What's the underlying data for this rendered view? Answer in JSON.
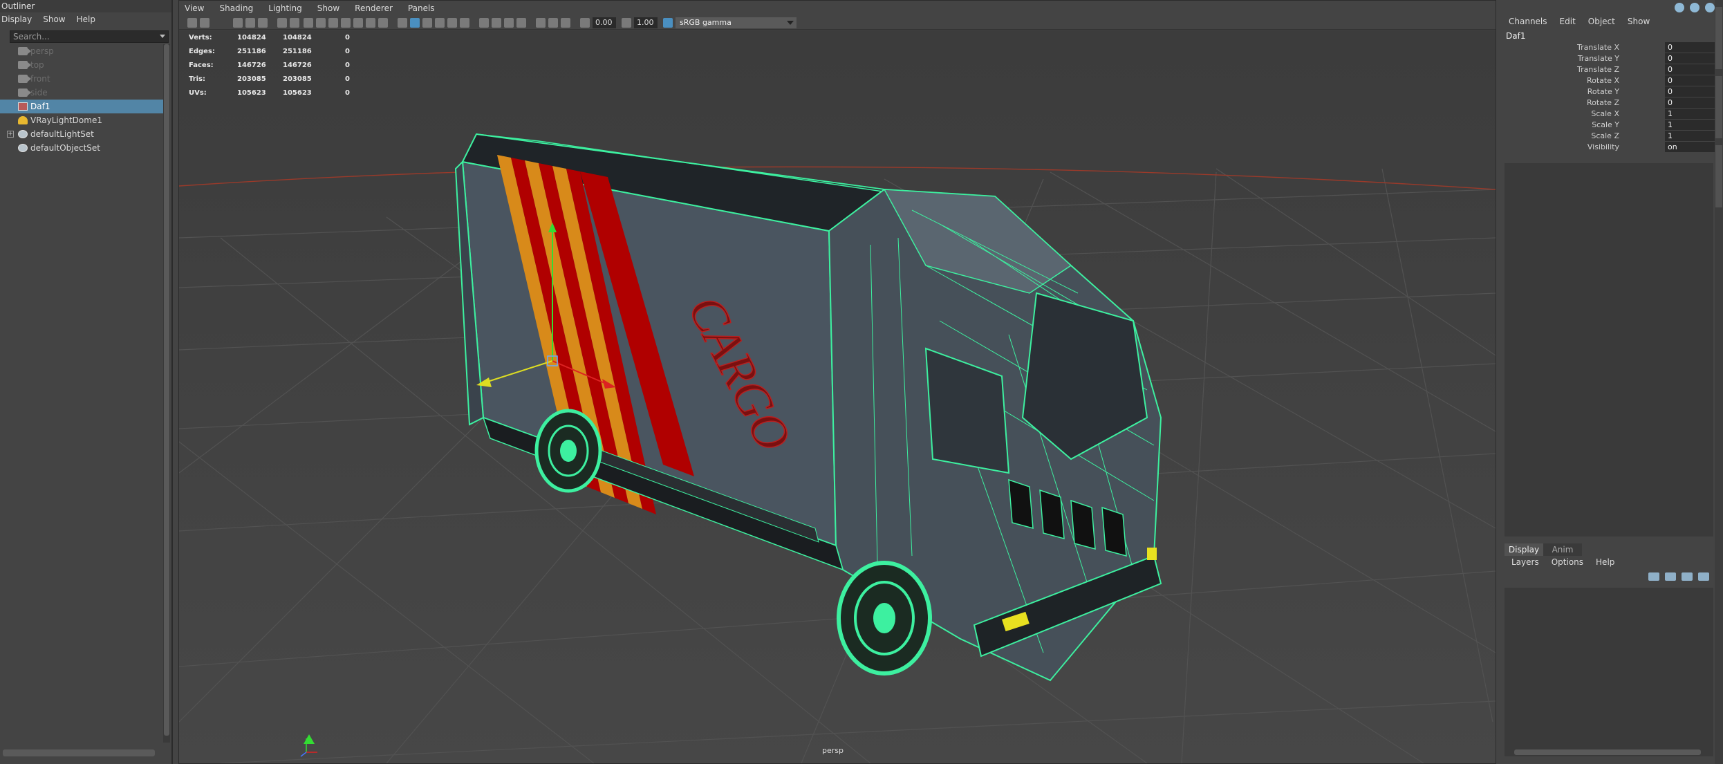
{
  "outliner": {
    "title": "Outliner",
    "menu": [
      "Display",
      "Show",
      "Help"
    ],
    "search_placeholder": "Search...",
    "items": [
      {
        "label": "persp",
        "icon": "camera-icon",
        "dim": true
      },
      {
        "label": "top",
        "icon": "camera-icon",
        "dim": true
      },
      {
        "label": "front",
        "icon": "camera-icon",
        "dim": true
      },
      {
        "label": "side",
        "icon": "camera-icon",
        "dim": true
      },
      {
        "label": "Daf1",
        "icon": "mesh-group-icon",
        "selected": true
      },
      {
        "label": "VRayLightDome1",
        "icon": "dome-light-icon"
      },
      {
        "label": "defaultLightSet",
        "icon": "set-icon",
        "expandable": true
      },
      {
        "label": "defaultObjectSet",
        "icon": "set-icon"
      }
    ]
  },
  "viewport": {
    "menu": [
      "View",
      "Shading",
      "Lighting",
      "Show",
      "Renderer",
      "Panels"
    ],
    "exposure": "0.00",
    "gamma": "1.00",
    "color_space": "sRGB gamma",
    "camera": "persp",
    "stats": [
      {
        "label": "Verts:",
        "v1": "104824",
        "v2": "104824",
        "v3": "0"
      },
      {
        "label": "Edges:",
        "v1": "251186",
        "v2": "251186",
        "v3": "0"
      },
      {
        "label": "Faces:",
        "v1": "146726",
        "v2": "146726",
        "v3": "0"
      },
      {
        "label": "Tris:",
        "v1": "203085",
        "v2": "203085",
        "v3": "0"
      },
      {
        "label": "UVs:",
        "v1": "105623",
        "v2": "105623",
        "v3": "0"
      }
    ],
    "truck_text": "CARGO",
    "colors": {
      "wireframe": "#3df0a0",
      "body": "#4a5560",
      "stripe_orange": "#d88a1a",
      "stripe_red": "#b00000",
      "grid": "#555555",
      "horizon": "#9a3a2a"
    }
  },
  "channels": {
    "menu": [
      "Channels",
      "Edit",
      "Object",
      "Show"
    ],
    "object": "Daf1",
    "attributes": [
      {
        "name": "Translate X",
        "value": "0"
      },
      {
        "name": "Translate Y",
        "value": "0"
      },
      {
        "name": "Translate Z",
        "value": "0"
      },
      {
        "name": "Rotate X",
        "value": "0"
      },
      {
        "name": "Rotate Y",
        "value": "0"
      },
      {
        "name": "Rotate Z",
        "value": "0"
      },
      {
        "name": "Scale X",
        "value": "1"
      },
      {
        "name": "Scale Y",
        "value": "1"
      },
      {
        "name": "Scale Z",
        "value": "1"
      },
      {
        "name": "Visibility",
        "value": "on"
      }
    ],
    "layer_tabs": [
      "Display",
      "Anim"
    ],
    "layer_menu": [
      "Layers",
      "Options",
      "Help"
    ]
  }
}
